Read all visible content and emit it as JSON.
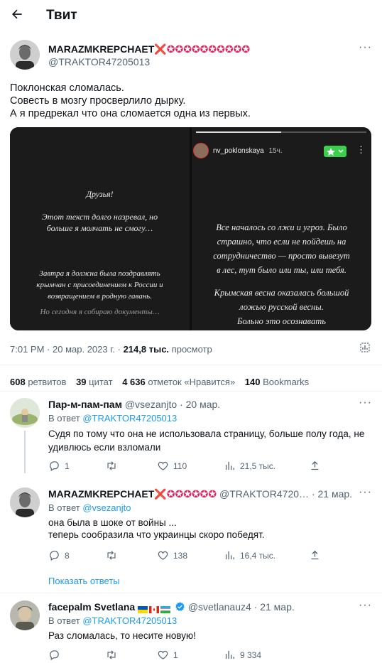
{
  "header": {
    "back_icon": "arrow-left-icon",
    "title": "Твит"
  },
  "main_tweet": {
    "author_name": "MARAZMKREPCHAET",
    "author_suffix": "❌✪✪✪✪✪✪✪✪✪✪",
    "author_handle": "@TRAKTOR47205013",
    "text_lines": [
      "Поклонская сломалась.",
      "Совесть  в мозгу просверлило дырку.",
      "А я предрекал что она сломается одна из первых."
    ],
    "media": {
      "left_lines": [
        "Друзья!",
        "Этот текст долго назревал, но",
        "больше я молчать не смогу…",
        "Завтра я должна была поздравлять",
        "крымчан с присоединением к России и",
        "возвращением в родную гавань.",
        "Но сегодня я собираю документы…"
      ],
      "right_username": "nv_poklonskaya",
      "right_time": "15ч.",
      "right_lines": [
        "Все началось со лжи и угроз. Было",
        "страшно, что если не пойдешь на",
        "сотрудничество — просто вывезут",
        "в лес, тут было или ты, или тебя.",
        "Крымская весна оказалась большой",
        "ложью русской весны.",
        "Больно это осознавать"
      ]
    },
    "time": "7:01 PM",
    "date": "20 мар. 2023 г.",
    "views_num": "214,8 тыс.",
    "views_label": "просмотр",
    "stats": {
      "retweets_num": "608",
      "retweets_label": "ретвитов",
      "quotes_num": "39",
      "quotes_label": "цитат",
      "likes_num": "4 636",
      "likes_label": "отметок «Нравится»",
      "bookmarks_num": "140",
      "bookmarks_label": "Bookmarks"
    }
  },
  "reply_prefix": "В ответ",
  "replies": [
    {
      "name": "Пар-м-пам-пам",
      "handle": "@vsezanjto",
      "date": "· 20 мар.",
      "reply_to": "@TRAKTOR47205013",
      "text_lines": [
        "Судя по тому что она не использовала страницу, больше полу года, не",
        "удивлюсь если взломали"
      ],
      "replies": "1",
      "retweets": "",
      "likes": "110",
      "views": "21,5 тыс."
    },
    {
      "name": "MARAZMKREPCHAET",
      "name_suffix": "❌✪✪✪✪✪✪",
      "handle": "@TRAKTOR4720…",
      "date": "· 21 мар.",
      "reply_to": "@vsezanjto",
      "text_lines": [
        "она была в шоке от войны ...",
        "теперь сообразила что украинцы скоро победят."
      ],
      "replies": "8",
      "retweets": "",
      "likes": "138",
      "views": "16,4 тыс."
    },
    {
      "name": "facepalm Svetlana",
      "handle": "@svetlanauz4",
      "date": "· 21 мар.",
      "reply_to": "@TRAKTOR47205013",
      "text_lines": [
        "Раз сломалась, то несите новую!"
      ],
      "replies": "",
      "retweets": "",
      "likes": "1",
      "views": "9 334"
    }
  ],
  "show_more_label": "Показать ответы",
  "colors": {
    "accent": "#1d9bf0",
    "muted": "#536471",
    "divider": "#eff3f4",
    "red_x": "#e0245e"
  }
}
